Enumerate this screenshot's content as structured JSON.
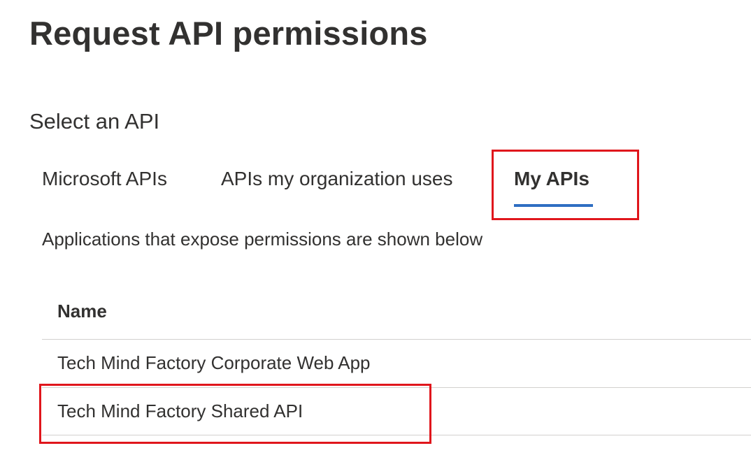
{
  "page": {
    "title": "Request API permissions"
  },
  "section": {
    "title": "Select an API"
  },
  "tabs": [
    {
      "label": "Microsoft APIs",
      "selected": false
    },
    {
      "label": "APIs my organization uses",
      "selected": false
    },
    {
      "label": "My APIs",
      "selected": true
    }
  ],
  "description": "Applications that expose permissions are shown below",
  "table": {
    "columns": [
      "Name"
    ],
    "rows": [
      {
        "name": "Tech Mind Factory Corporate Web App"
      },
      {
        "name": "Tech Mind Factory Shared API"
      }
    ]
  },
  "colors": {
    "accent": "#2f6ec2",
    "highlight": "#e0161c",
    "text": "#323130",
    "divider": "#d2d0ce"
  }
}
